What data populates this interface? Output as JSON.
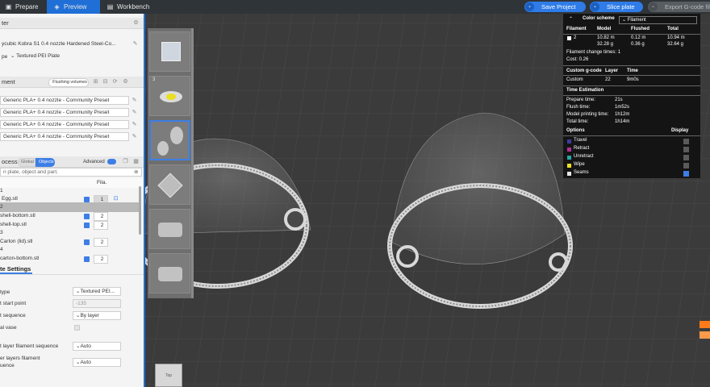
{
  "topbar": {
    "tabs": [
      {
        "label": "Prepare",
        "icon": "cube-icon"
      },
      {
        "label": "Preview",
        "icon": "preview-icon"
      },
      {
        "label": "Workbench",
        "icon": "workbench-icon"
      }
    ],
    "save_project": "Save Project",
    "slice_plate": "Slice plate",
    "export_gcode": "Export G-code fil"
  },
  "left": {
    "printer_header": "ter",
    "printer_name": "ycubic Kobra S1 0.4 nozzle Hardened Steel-Co...",
    "plate_label": "pe",
    "plate_value": "Textured PEI Plate",
    "filament_header": "ment",
    "flushing_volumes": "Flushing volumes",
    "filaments": [
      "Generic PLA+ 0.4 nozzle - Community Preset",
      "Generic PLA+ 0.4 nozzle - Community Preset",
      "Generic PLA+ 0.4 nozzle - Community Preset",
      "Generic PLA+ 0.4 nozzle - Community Preset"
    ],
    "process_header": "ocess",
    "global": "Global",
    "objects": "Objects",
    "advanced": "Advanced",
    "search_placeholder": "n plate, object and part.",
    "fila_col": "Fila.",
    "object_rows": [
      {
        "name": "1",
        "fila": ""
      },
      {
        "name": "Egg.stl",
        "fila": "1"
      },
      {
        "name": "2",
        "fila": ""
      },
      {
        "name": "shell-bottom.stl",
        "fila": "2"
      },
      {
        "name": "shell-top.stl",
        "fila": "2"
      },
      {
        "name": "3",
        "fila": ""
      },
      {
        "name": "Carton (lid).stl",
        "fila": "2"
      },
      {
        "name": "4",
        "fila": ""
      },
      {
        "name": "carton-bottom.stl",
        "fila": "2"
      }
    ],
    "plate_settings_tab": "te Settings",
    "settings": [
      {
        "label": "type",
        "value": "Textured PEI..."
      },
      {
        "label": "t start point",
        "value": "-135"
      },
      {
        "label": "t sequence",
        "value": "By layer"
      },
      {
        "label": "al vase",
        "value": ""
      },
      {
        "label": "t layer filament sequence",
        "value": "Auto"
      },
      {
        "label": "er layers filament",
        "label2": "uence",
        "value": "Auto"
      }
    ]
  },
  "thumbs": {
    "numbers": [
      "",
      "3",
      "",
      "",
      "",
      ""
    ]
  },
  "legend": {
    "color_scheme": "Color scheme",
    "scheme_value": "Filament",
    "headers": {
      "filament": "Filament",
      "model": "Model",
      "flushed": "Flushed",
      "total": "Total"
    },
    "row": {
      "idx": "2",
      "model_m": "10.82 m",
      "model_g": "32.28 g",
      "flushed_m": "0.12 m",
      "flushed_g": "0.36 g",
      "total_m": "10.94 m",
      "total_g": "32.64 g"
    },
    "change_times": "Filament change times:  1",
    "cost": "Cost:  0.26",
    "custom_header": {
      "a": "Custom g-code",
      "b": "Layer",
      "c": "Time"
    },
    "custom_row": {
      "a": "Custom",
      "b": "22",
      "c": "9m0s"
    },
    "time_estimation": "Time Estimation",
    "times": [
      {
        "label": "Prepare time:",
        "value": "21s"
      },
      {
        "label": "Flush time:",
        "value": "1m52s"
      },
      {
        "label": "Model printing time:",
        "value": "1h12m"
      },
      {
        "label": "Total time:",
        "value": "1h14m"
      }
    ],
    "options_header": "Options",
    "display_header": "Display",
    "options": [
      {
        "label": "Travel",
        "color": "#3d3d9e"
      },
      {
        "label": "Retract",
        "color": "#b0309a"
      },
      {
        "label": "Unretract",
        "color": "#2aa5a5"
      },
      {
        "label": "Wipe",
        "color": "#f0e020"
      },
      {
        "label": "Seams",
        "color": "#e6e6e6"
      }
    ]
  },
  "viewport": {
    "cube_label": "Top"
  }
}
